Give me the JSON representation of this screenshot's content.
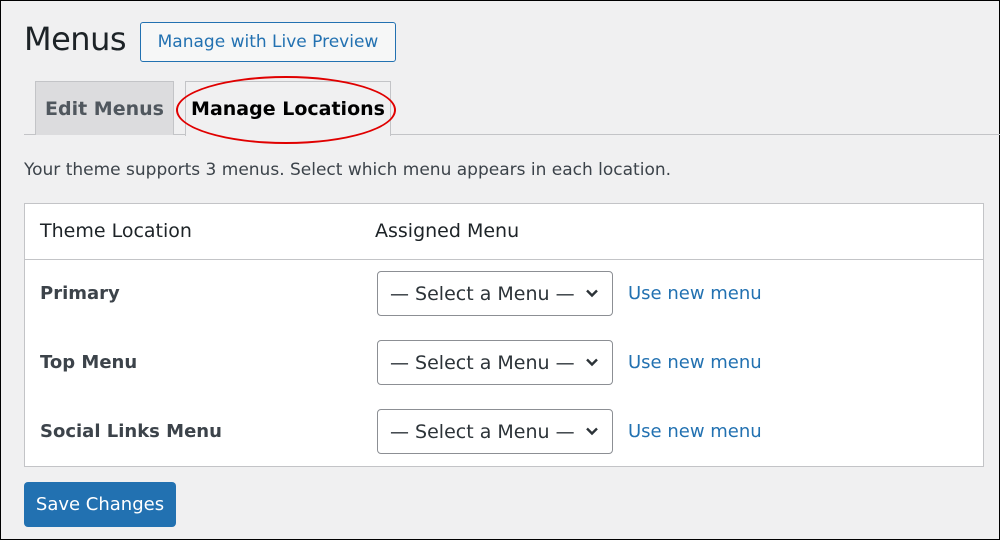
{
  "header": {
    "title": "Menus",
    "live_preview_label": "Manage with Live Preview"
  },
  "tabs": [
    {
      "label": "Edit Menus",
      "active": false
    },
    {
      "label": "Manage Locations",
      "active": true
    }
  ],
  "description": "Your theme supports 3 menus. Select which menu appears in each location.",
  "table": {
    "columns": [
      "Theme Location",
      "Assigned Menu"
    ],
    "rows": [
      {
        "location": "Primary",
        "selected": "— Select a Menu —",
        "link": "Use new menu"
      },
      {
        "location": "Top Menu",
        "selected": "— Select a Menu —",
        "link": "Use new menu"
      },
      {
        "location": "Social Links Menu",
        "selected": "— Select a Menu —",
        "link": "Use new menu"
      }
    ]
  },
  "actions": {
    "save_label": "Save Changes"
  },
  "colors": {
    "accent": "#2271b1",
    "highlight": "#e00000",
    "background": "#f0f0f1"
  }
}
